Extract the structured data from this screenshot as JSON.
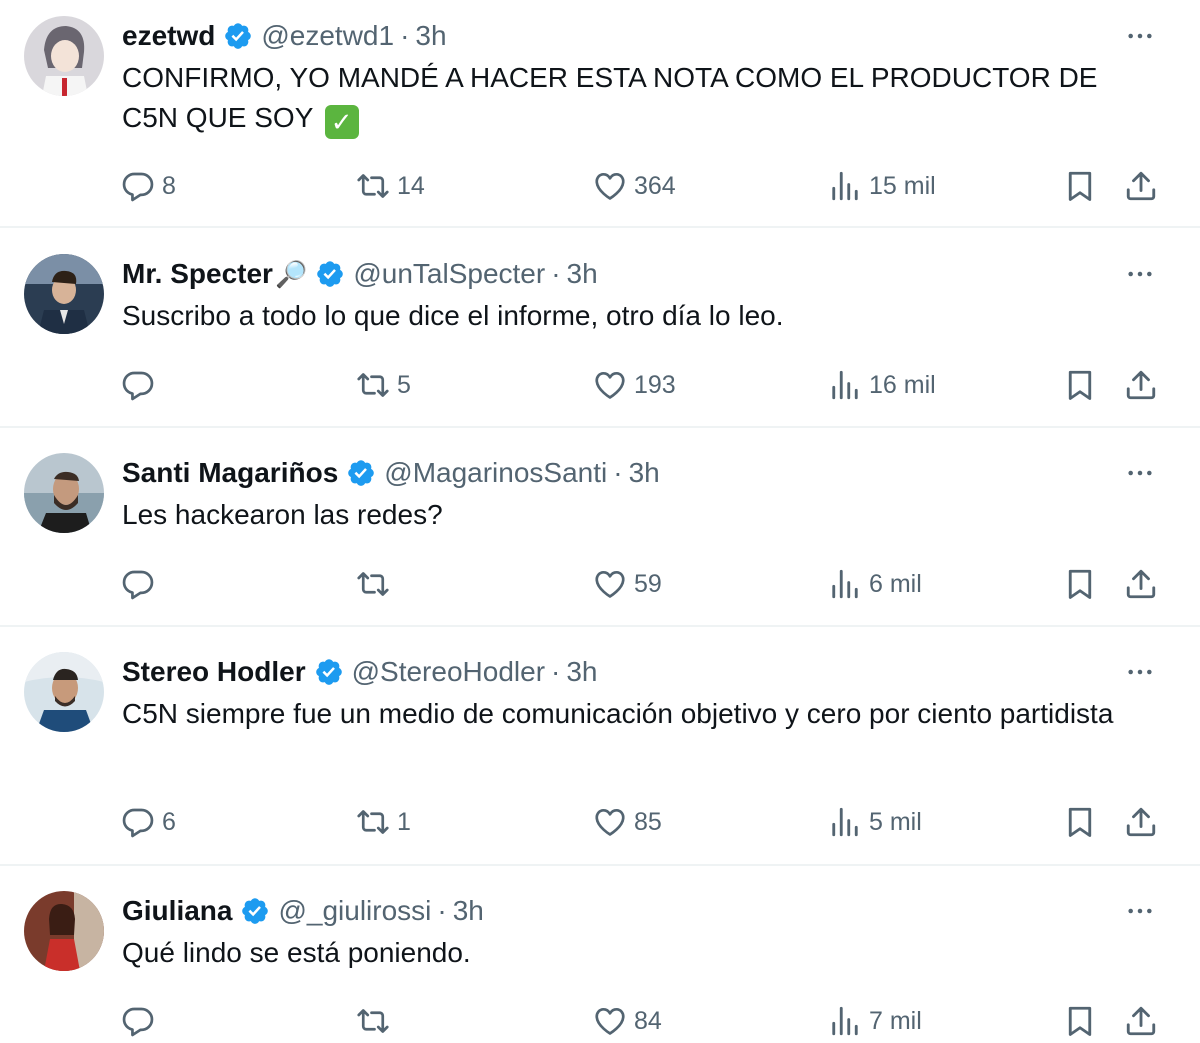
{
  "colors": {
    "accent": "#1d9bf0",
    "text": "#0f1419",
    "muted": "#536471",
    "divider": "#eff3f4",
    "check_emoji": "#5bb53f"
  },
  "tweets": [
    {
      "name": "ezetwd",
      "handle": "@ezetwd1",
      "dot": "·",
      "time": "3h",
      "text_main": "CONFIRMO, YO MANDÉ A HACER ESTA NOTA COMO EL PRODUCTOR DE C5N QUE SOY",
      "text_emoji": "✓",
      "replies": "8",
      "retweets": "14",
      "likes": "364",
      "views": "15 mil"
    },
    {
      "name": "Mr. Specter",
      "name_emoji": "🔎",
      "handle": "@unTalSpecter",
      "dot": "·",
      "time": "3h",
      "text_main": "Suscribo a todo lo que dice el informe, otro día lo leo.",
      "replies": "",
      "retweets": "5",
      "likes": "193",
      "views": "16 mil"
    },
    {
      "name": "Santi Magariños",
      "handle": "@MagarinosSanti",
      "dot": "·",
      "time": "3h",
      "text_main": "Les hackearon las redes?",
      "replies": "",
      "retweets": "",
      "likes": "59",
      "views": "6 mil"
    },
    {
      "name": "Stereo Hodler",
      "handle": "@StereoHodler",
      "dot": "·",
      "time": "3h",
      "text_main": "C5N siempre fue un medio de comunicación objetivo y cero por ciento partidista",
      "replies": "6",
      "retweets": "1",
      "likes": "85",
      "views": "5 mil"
    },
    {
      "name": "Giuliana",
      "handle": "@_giulirossi",
      "dot": "·",
      "time": "3h",
      "text_main": "Qué lindo se está poniendo.",
      "replies": "",
      "retweets": "",
      "likes": "84",
      "views": "7 mil"
    }
  ]
}
